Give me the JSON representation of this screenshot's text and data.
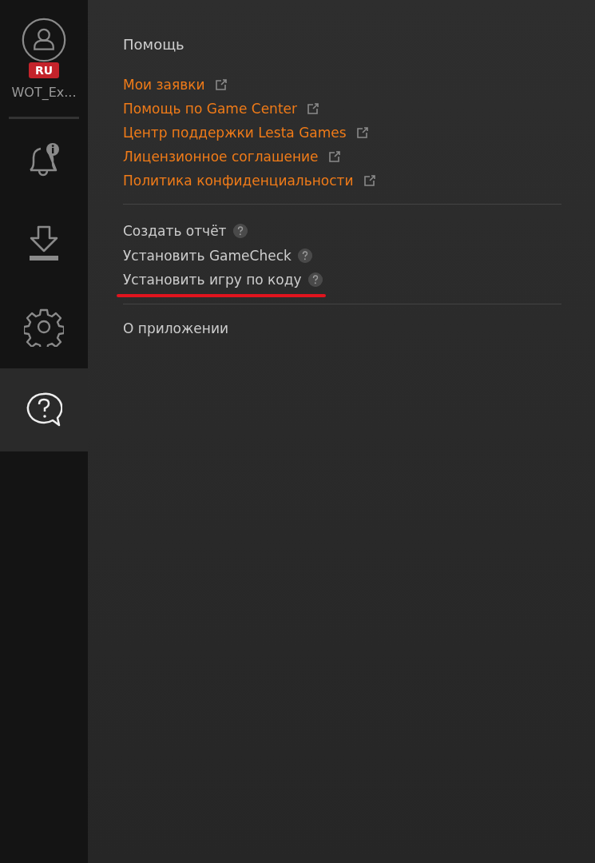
{
  "sidebar": {
    "profile": {
      "region": "RU",
      "name": "WOT_Ex..."
    },
    "items": [
      {
        "kind": "notifications",
        "selected": false
      },
      {
        "kind": "downloads",
        "selected": false
      },
      {
        "kind": "settings",
        "selected": false
      },
      {
        "kind": "help",
        "selected": true
      }
    ]
  },
  "help": {
    "title": "Помощь",
    "links": [
      "Мои заявки",
      "Помощь по Game Center",
      "Центр поддержки Lesta Games",
      "Лицензионное соглашение",
      "Политика конфиденциальности"
    ],
    "tools": [
      {
        "label": "Создать отчёт",
        "underlined": false
      },
      {
        "label": "Установить GameCheck",
        "underlined": false
      },
      {
        "label": "Установить игру по коду",
        "underlined": true
      }
    ],
    "about": "О приложении"
  }
}
